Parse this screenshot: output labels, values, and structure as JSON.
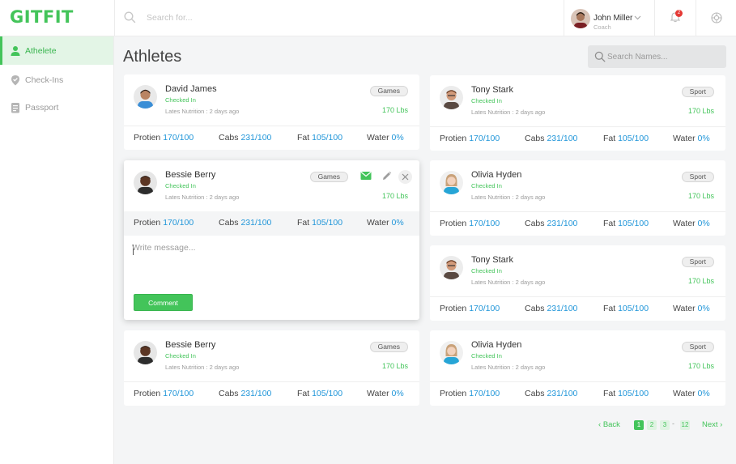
{
  "app": {
    "logo": "GITFIT"
  },
  "header": {
    "search_placeholder": "Search for...",
    "user": {
      "name": "John Miller",
      "role": "Coach"
    },
    "notifications": {
      "count": "2"
    }
  },
  "sidebar": {
    "items": [
      {
        "label": "Athelete",
        "icon": "user-icon",
        "active": true
      },
      {
        "label": "Check-Ins",
        "icon": "location-pin-icon",
        "active": false
      },
      {
        "label": "Passport",
        "icon": "passport-icon",
        "active": false
      }
    ]
  },
  "page": {
    "title": "Athletes",
    "search_placeholder": "Search Names..."
  },
  "stat_labels": {
    "protein": "Protien",
    "carbs": "Cabs",
    "fat": "Fat",
    "water": "Water"
  },
  "athletes": [
    {
      "name": "David James",
      "status": "Checked In",
      "note": "Lates Nutrition : 2 days ago",
      "tag": "Games",
      "weight": "170 Lbs",
      "protein": "170/100",
      "carbs": "231/100",
      "fat": "105/100",
      "water": "0%"
    },
    {
      "name": "Tony Stark",
      "status": "Checked In",
      "note": "Lates Nutrition : 2 days ago",
      "tag": "Sport",
      "weight": "170 Lbs",
      "protein": "170/100",
      "carbs": "231/100",
      "fat": "105/100",
      "water": "0%"
    },
    {
      "name": "Bessie Berry",
      "status": "Checked In",
      "note": "Lates Nutrition : 2 days ago",
      "tag": "Games",
      "weight": "170 Lbs",
      "protein": "170/100",
      "carbs": "231/100",
      "fat": "105/100",
      "water": "0%"
    },
    {
      "name": "Olivia Hyden",
      "status": "Checked In",
      "note": "Lates Nutrition : 2 days ago",
      "tag": "Sport",
      "weight": "170 Lbs",
      "protein": "170/100",
      "carbs": "231/100",
      "fat": "105/100",
      "water": "0%"
    },
    {
      "name": "Tony Stark",
      "status": "Checked In",
      "note": "Lates Nutrition : 2 days ago",
      "tag": "Sport",
      "weight": "170 Lbs",
      "protein": "170/100",
      "carbs": "231/100",
      "fat": "105/100",
      "water": "0%"
    },
    {
      "name": "Bessie Berry",
      "status": "Checked In",
      "note": "Lates Nutrition : 2 days ago",
      "tag": "Games",
      "weight": "170 Lbs",
      "protein": "170/100",
      "carbs": "231/100",
      "fat": "105/100",
      "water": "0%"
    },
    {
      "name": "Olivia Hyden",
      "status": "Checked In",
      "note": "Lates Nutrition : 2 days ago",
      "tag": "Sport",
      "weight": "170 Lbs",
      "protein": "170/100",
      "carbs": "231/100",
      "fat": "105/100",
      "water": "0%"
    }
  ],
  "message": {
    "placeholder": "Write message...",
    "button": "Comment"
  },
  "pagination": {
    "back": "Back",
    "next": "Next",
    "pages": [
      "1",
      "2",
      "3",
      "12"
    ],
    "ellipsis": "-",
    "current": "1"
  },
  "colors": {
    "accent": "#43c45a",
    "value": "#2196d9",
    "background": "#f4f5f6"
  }
}
